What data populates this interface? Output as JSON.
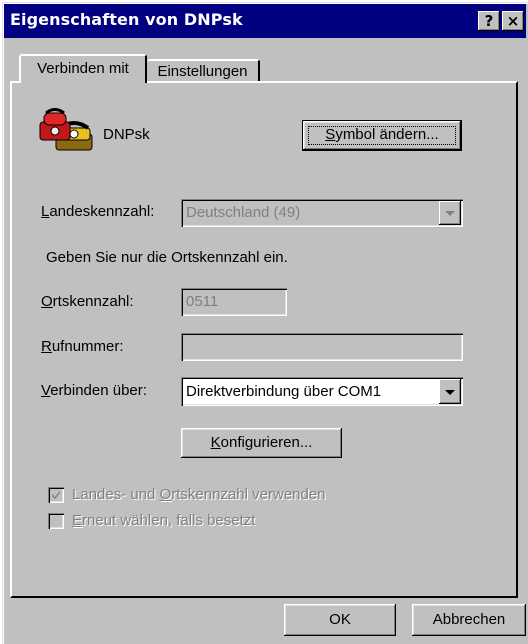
{
  "window": {
    "title": "Eigenschaften von DNPsk",
    "help_button": "?",
    "close_button": "×"
  },
  "tabs": [
    {
      "label": "Verbinden mit",
      "active": true
    },
    {
      "label": "Einstellungen",
      "active": false
    }
  ],
  "connection": {
    "icon": "phone-icon",
    "name": "DNPsk",
    "change_icon_button": {
      "pre": "",
      "key": "S",
      "post": "ymbol ändern..."
    }
  },
  "country_code": {
    "label": {
      "pre": "",
      "key": "L",
      "post": "andeskennzahl:"
    },
    "value": "Deutschland (49)",
    "enabled": false
  },
  "hint": "Geben Sie nur die Ortskennzahl ein.",
  "area_code": {
    "label": {
      "pre": "",
      "key": "O",
      "post": "rtskennzahl:"
    },
    "value": "0511",
    "enabled": false
  },
  "phone_number": {
    "label": {
      "pre": "",
      "key": "R",
      "post": "ufnummer:"
    },
    "value": "",
    "enabled": false
  },
  "connect_via": {
    "label": {
      "pre": "",
      "key": "V",
      "post": "erbinden über:"
    },
    "value": "Direktverbindung über COM1"
  },
  "configure_button": {
    "pre": "",
    "key": "K",
    "post": "onfigurieren..."
  },
  "use_codes_checkbox": {
    "label": {
      "pre": "Landes- und ",
      "key": "O",
      "post": "rtskennzahl verwenden"
    },
    "checked": true,
    "enabled": false
  },
  "redial_checkbox": {
    "label": {
      "pre": "",
      "key": "E",
      "post": "rneut wählen, falls besetzt"
    },
    "checked": false,
    "enabled": false
  },
  "footer": {
    "ok_label": "OK",
    "cancel_label": "Abbrechen"
  },
  "colors": {
    "titlebar": "#000080",
    "face": "#c0c0c0",
    "disabled_text": "#808080"
  }
}
